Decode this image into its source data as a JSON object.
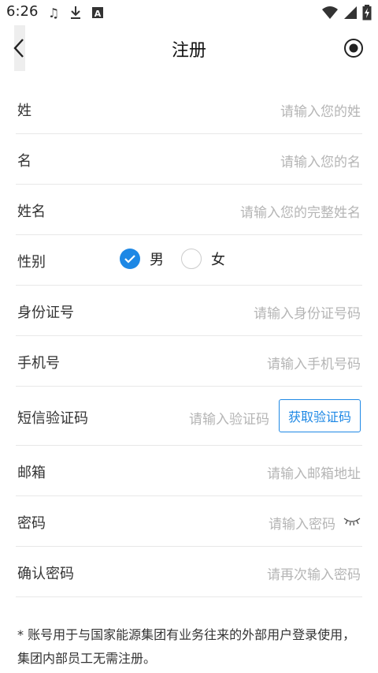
{
  "status": {
    "time": "6:26",
    "left_icons": [
      "music-note-icon",
      "download-icon",
      "a-box-icon"
    ],
    "right_icons": [
      "wifi-icon",
      "signal-icon",
      "battery-charging-icon"
    ]
  },
  "navbar": {
    "title": "注册"
  },
  "form": {
    "last_name": {
      "label": "姓",
      "placeholder": "请输入您的姓"
    },
    "first_name": {
      "label": "名",
      "placeholder": "请输入您的名"
    },
    "full_name": {
      "label": "姓名",
      "placeholder": "请输入您的完整姓名"
    },
    "gender": {
      "label": "性别",
      "options": [
        "男",
        "女"
      ],
      "selected": "男"
    },
    "id_number": {
      "label": "身份证号",
      "placeholder": "请输入身份证号码"
    },
    "phone": {
      "label": "手机号",
      "placeholder": "请输入手机号码"
    },
    "sms_code": {
      "label": "短信验证码",
      "placeholder": "请输入验证码",
      "button": "获取验证码"
    },
    "email": {
      "label": "邮箱",
      "placeholder": "请输入邮箱地址"
    },
    "password": {
      "label": "密码",
      "placeholder": "请输入密码"
    },
    "confirm_password": {
      "label": "确认密码",
      "placeholder": "请再次输入密码"
    }
  },
  "footnote": "* 账号用于与国家能源集团有业务往来的外部用户登录使用，集团内部员工无需注册。",
  "colors": {
    "accent": "#1e88e5",
    "placeholder": "#b5b5b5",
    "divider": "#e8e8e8"
  }
}
